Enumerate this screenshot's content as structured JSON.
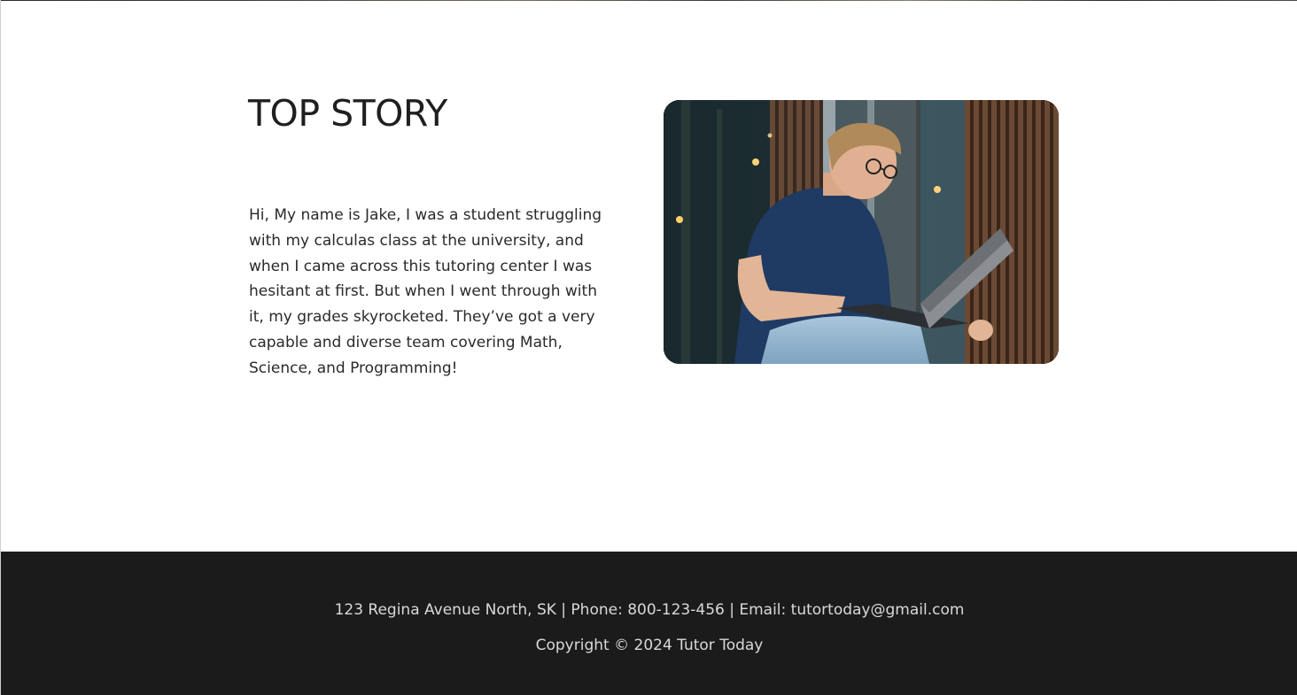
{
  "story": {
    "title": "TOP STORY",
    "body": "Hi, My name is Jake, I was a student struggling with my calculas class at the university, and when I came across this tutoring center I was hesitant at first. But when I went through with it, my grades skyrocketed. They’ve got a very capable and diverse team covering Math, Science, and Programming!",
    "photo_icon": "student-with-laptop-photo"
  },
  "footer": {
    "contact": "123 Regina Avenue North, SK | Phone: 800-123-456 | Email: tutortoday@gmail.com",
    "copyright": "Copyright © 2024 Tutor Today"
  },
  "colors": {
    "footer_background": "#1b1b1b",
    "footer_text": "#d9d9d9",
    "heading_text": "#1f1f1f",
    "body_text": "#2a2a2a"
  }
}
